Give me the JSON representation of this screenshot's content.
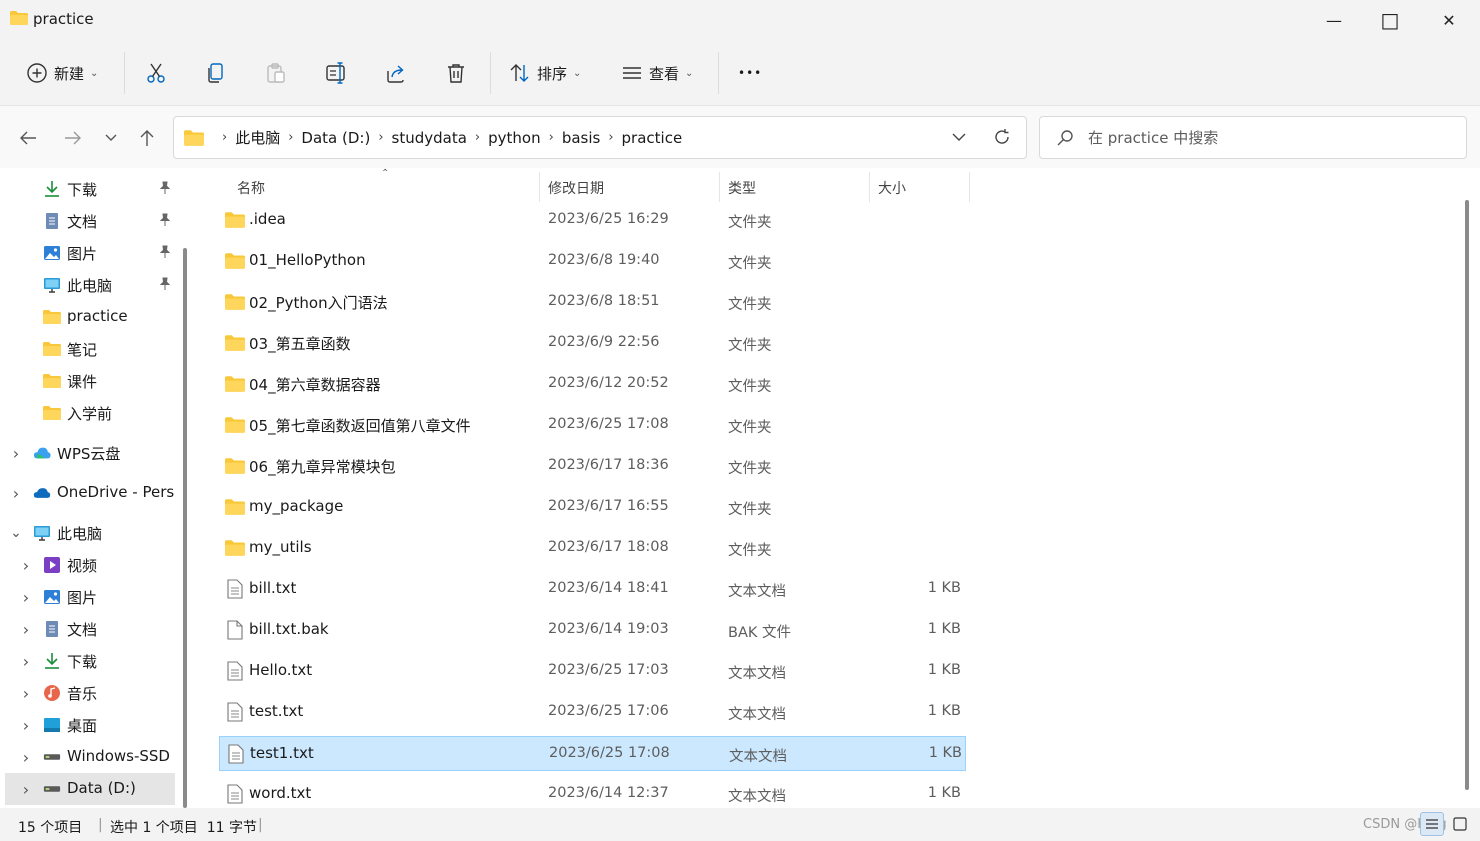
{
  "window": {
    "title": "practice",
    "minimize_glyph": "—",
    "maximize_glyph": "□",
    "close_glyph": "✕"
  },
  "commandbar": {
    "new_label": "新建",
    "sort_label": "排序",
    "view_label": "查看",
    "more_label": "•••"
  },
  "address": {
    "crumbs": [
      "此电脑",
      "Data (D:)",
      "studydata",
      "python",
      "basis",
      "practice"
    ]
  },
  "search": {
    "placeholder": "在 practice 中搜索"
  },
  "sidebar": {
    "items": [
      {
        "label": "下载",
        "icon": "download-icon",
        "pinned": true
      },
      {
        "label": "文档",
        "icon": "document-icon",
        "pinned": true
      },
      {
        "label": "图片",
        "icon": "pictures-icon",
        "pinned": true
      },
      {
        "label": "此电脑",
        "icon": "computer-icon",
        "pinned": true
      },
      {
        "label": "practice",
        "icon": "folder-icon"
      },
      {
        "label": "笔记",
        "icon": "folder-icon"
      },
      {
        "label": "课件",
        "icon": "folder-icon"
      },
      {
        "label": "入学前",
        "icon": "folder-icon"
      },
      {
        "label": "WPS云盘",
        "icon": "cloud-icon"
      },
      {
        "label": "OneDrive - Perso",
        "icon": "onedrive-icon"
      },
      {
        "label": "此电脑",
        "icon": "computer-icon"
      },
      {
        "label": "视频",
        "icon": "video-icon"
      },
      {
        "label": "图片",
        "icon": "pictures-icon"
      },
      {
        "label": "文档",
        "icon": "document-icon"
      },
      {
        "label": "下载",
        "icon": "download-icon"
      },
      {
        "label": "音乐",
        "icon": "music-icon"
      },
      {
        "label": "桌面",
        "icon": "desktop-icon"
      },
      {
        "label": "Windows-SSD (",
        "icon": "drive-icon"
      },
      {
        "label": "Data (D:)",
        "icon": "drive-icon"
      }
    ]
  },
  "columns": {
    "name": "名称",
    "date": "修改日期",
    "type": "类型",
    "size": "大小"
  },
  "files": [
    {
      "name": ".idea",
      "date": "2023/6/25 16:29",
      "type": "文件夹",
      "size": "",
      "icon": "folder-icon"
    },
    {
      "name": "01_HelloPython",
      "date": "2023/6/8 19:40",
      "type": "文件夹",
      "size": "",
      "icon": "folder-icon"
    },
    {
      "name": "02_Python入门语法",
      "date": "2023/6/8 18:51",
      "type": "文件夹",
      "size": "",
      "icon": "folder-icon"
    },
    {
      "name": "03_第五章函数",
      "date": "2023/6/9 22:56",
      "type": "文件夹",
      "size": "",
      "icon": "folder-icon"
    },
    {
      "name": "04_第六章数据容器",
      "date": "2023/6/12 20:52",
      "type": "文件夹",
      "size": "",
      "icon": "folder-icon"
    },
    {
      "name": "05_第七章函数返回值第八章文件",
      "date": "2023/6/25 17:08",
      "type": "文件夹",
      "size": "",
      "icon": "folder-icon"
    },
    {
      "name": "06_第九章异常模块包",
      "date": "2023/6/17 18:36",
      "type": "文件夹",
      "size": "",
      "icon": "folder-icon"
    },
    {
      "name": "my_package",
      "date": "2023/6/17 16:55",
      "type": "文件夹",
      "size": "",
      "icon": "folder-icon"
    },
    {
      "name": "my_utils",
      "date": "2023/6/17 18:08",
      "type": "文件夹",
      "size": "",
      "icon": "folder-icon"
    },
    {
      "name": "bill.txt",
      "date": "2023/6/14 18:41",
      "type": "文本文档",
      "size": "1 KB",
      "icon": "text-file-icon"
    },
    {
      "name": "bill.txt.bak",
      "date": "2023/6/14 19:03",
      "type": "BAK 文件",
      "size": "1 KB",
      "icon": "blank-file-icon"
    },
    {
      "name": "Hello.txt",
      "date": "2023/6/25 17:03",
      "type": "文本文档",
      "size": "1 KB",
      "icon": "text-file-icon"
    },
    {
      "name": "test.txt",
      "date": "2023/6/25 17:06",
      "type": "文本文档",
      "size": "1 KB",
      "icon": "text-file-icon"
    },
    {
      "name": "test1.txt",
      "date": "2023/6/25 17:08",
      "type": "文本文档",
      "size": "1 KB",
      "icon": "text-file-icon",
      "selected": true
    },
    {
      "name": "word.txt",
      "date": "2023/6/14 12:37",
      "type": "文本文档",
      "size": "1 KB",
      "icon": "text-file-icon"
    }
  ],
  "status": {
    "count": "15 个项目",
    "selection": "选中 1 个项目  11 字节",
    "watermark": "CSDN @Hi  lg"
  },
  "colors": {
    "folder": "#f8c83a",
    "selected_row": "#cce8ff",
    "accent": "#0067c0"
  }
}
